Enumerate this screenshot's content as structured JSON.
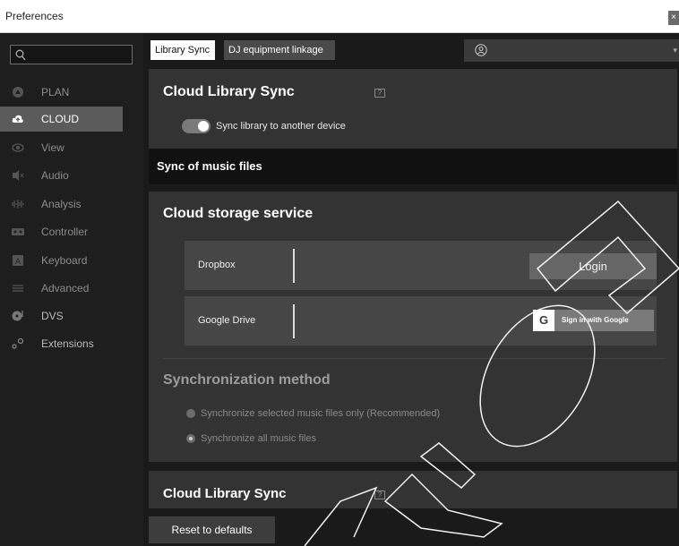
{
  "window": {
    "title": "Preferences",
    "close_glyph": "×"
  },
  "sidebar": {
    "search": {
      "placeholder": "",
      "icon": "search-icon"
    },
    "items": [
      {
        "label": "PLAN",
        "icon": "plan-icon",
        "active": false
      },
      {
        "label": "CLOUD",
        "icon": "cloud-icon",
        "active": true
      },
      {
        "label": "View",
        "icon": "eye-icon",
        "active": false
      },
      {
        "label": "Audio",
        "icon": "speaker-icon",
        "active": false
      },
      {
        "label": "Analysis",
        "icon": "waveform-icon",
        "active": false
      },
      {
        "label": "Controller",
        "icon": "controller-icon",
        "active": false
      },
      {
        "label": "Keyboard",
        "icon": "keyboard-icon",
        "active": false
      },
      {
        "label": "Advanced",
        "icon": "menu-lines-icon",
        "active": false
      },
      {
        "label": "DVS",
        "icon": "dvs-icon",
        "active": false
      },
      {
        "label": "Extensions",
        "icon": "extensions-icon",
        "active": false
      }
    ]
  },
  "tabs": [
    {
      "label": "Library Sync",
      "active": true
    },
    {
      "label": "DJ equipment linkage",
      "active": false
    }
  ],
  "user_select": {
    "icon": "user-icon",
    "value": ""
  },
  "cloud_sync": {
    "title": "Cloud Library Sync",
    "help": "?",
    "toggle_label": "Sync library to another device",
    "toggle_on": true
  },
  "music_sync_header": "Sync of music files",
  "storage": {
    "title": "Cloud storage service",
    "services": [
      {
        "name": "Dropbox",
        "button": "Login"
      },
      {
        "name": "Google Drive",
        "button": "Sign in with Google",
        "button_icon": "G"
      }
    ]
  },
  "sync_method": {
    "title": "Synchronization method",
    "options": [
      {
        "label": "Synchronize selected music files only (Recommended)",
        "selected": false
      },
      {
        "label": "Synchronize all music files",
        "selected": true
      }
    ]
  },
  "cloud_sync_2": {
    "title": "Cloud Library Sync",
    "help": "?"
  },
  "reset_button": "Reset to defaults",
  "colors": {
    "background": "#1a1a1a",
    "panel": "#333333",
    "active_nav": "#5b5b5b",
    "row": "#464646"
  }
}
